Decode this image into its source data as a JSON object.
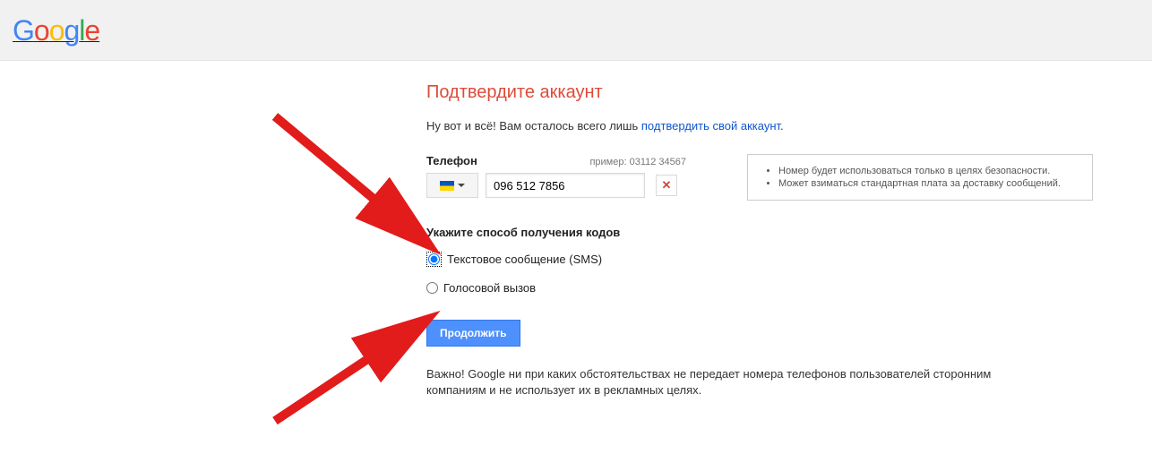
{
  "logo": "Google",
  "title": "Подтвердите аккаунт",
  "intro_prefix": "Ну вот и всё! Вам осталось всего лишь ",
  "intro_link": "подтвердить свой аккаунт",
  "intro_suffix": ".",
  "phone": {
    "label": "Телефон",
    "example": "пример: 03112 34567",
    "value": "096 512 7856",
    "country": "UA"
  },
  "info": {
    "items": [
      "Номер будет использоваться только в целях безопасности.",
      "Может взиматься стандартная плата за доставку сообщений."
    ]
  },
  "radio": {
    "label": "Укажите способ получения кодов",
    "sms": "Текстовое сообщение (SMS)",
    "voice": "Голосовой вызов"
  },
  "submit": "Продолжить",
  "notice": "Важно! Google ни при каких обстоятельствах не передает номера телефонов пользователей сторонним компаниям и не использует их в рекламных целях."
}
